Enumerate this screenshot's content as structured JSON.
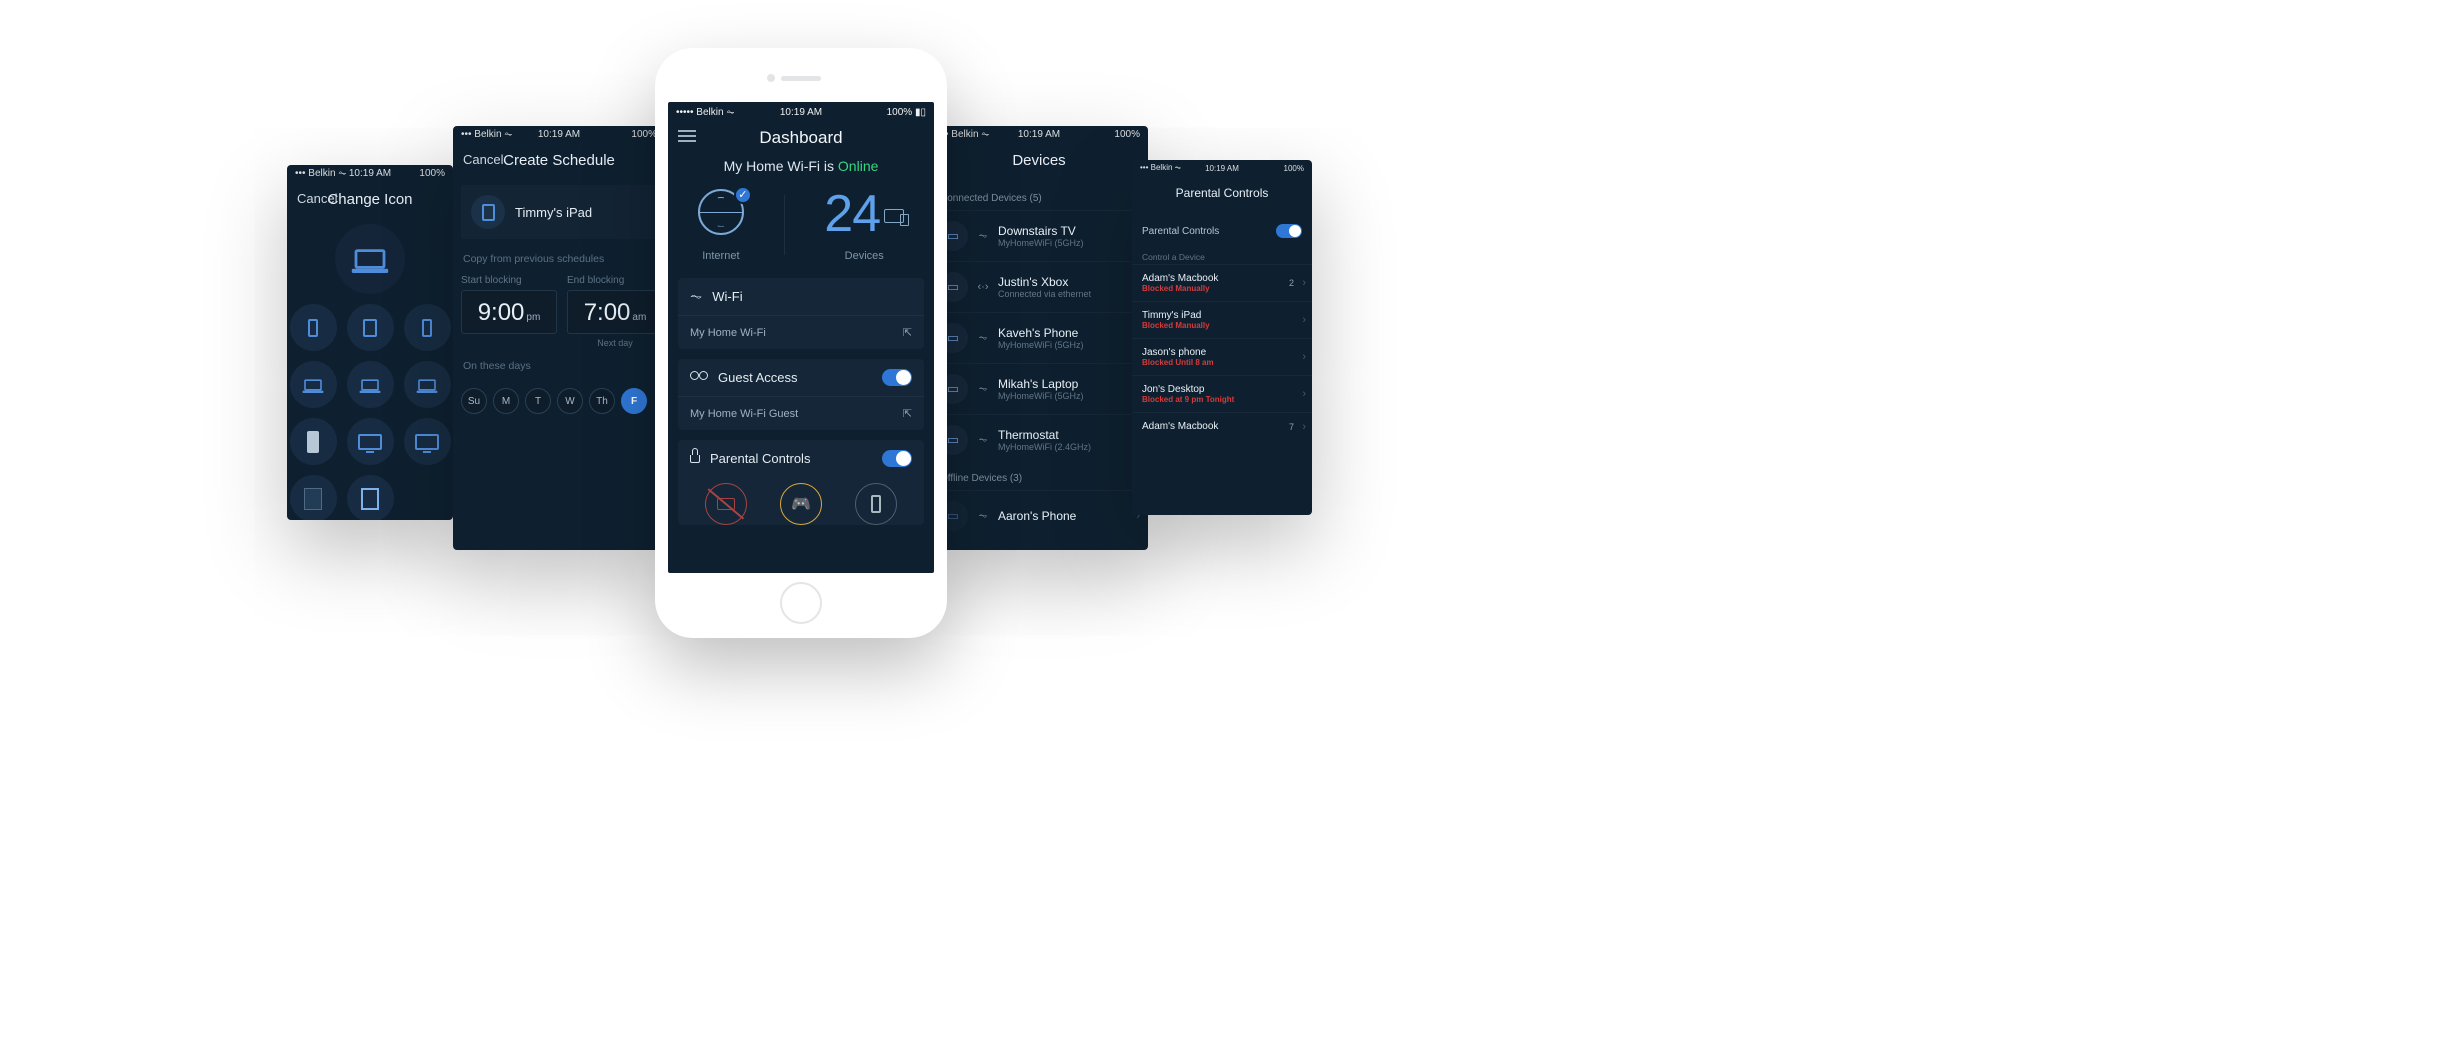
{
  "status": {
    "carrier": "Belkin",
    "time": "10:19 AM",
    "battery": "100%"
  },
  "center": {
    "title": "Dashboard",
    "headline_prefix": "My Home Wi-Fi is ",
    "headline_status": "Online",
    "internet_label": "Internet",
    "device_count": "24",
    "devices_label": "Devices",
    "wifi_label": "Wi-Fi",
    "wifi_network": "My Home Wi-Fi",
    "guest_label": "Guest Access",
    "guest_network": "My Home Wi-Fi Guest",
    "parental_label": "Parental Controls"
  },
  "schedule": {
    "cancel": "Cancel",
    "title": "Create Schedule",
    "device": "Timmy's iPad",
    "copy_hint": "Copy from previous schedules",
    "start_label": "Start blocking",
    "end_label": "End blocking",
    "start_time": "9:00",
    "start_ampm": "pm",
    "end_time": "7:00",
    "end_ampm": "am",
    "next_day": "Next day",
    "days_label": "On these days",
    "days": [
      "Su",
      "M",
      "T",
      "W",
      "Th",
      "F"
    ],
    "selected_day": "F"
  },
  "change_icon": {
    "cancel": "Cancel",
    "title": "Change Icon"
  },
  "devices": {
    "title": "Devices",
    "connected_hdr": "Connected Devices (5)",
    "offline_hdr": "Offline Devices   (3)",
    "list": [
      {
        "name": "Downstairs TV",
        "sub": "MyHomeWiFi     (5GHz)",
        "wifi": true
      },
      {
        "name": "Justin's Xbox",
        "sub": "Connected via ethernet",
        "wifi": false
      },
      {
        "name": "Kaveh's Phone",
        "sub": "MyHomeWiFi     (5GHz)",
        "wifi": true
      },
      {
        "name": "Mikah's Laptop",
        "sub": "MyHomeWiFi     (5GHz)",
        "wifi": true
      },
      {
        "name": "Thermostat",
        "sub": "MyHomeWiFi     (2.4GHz)",
        "wifi": true
      }
    ],
    "offline": {
      "name": "Aaron's Phone"
    }
  },
  "parental": {
    "title": "Parental Controls",
    "toggle_label": "Parental Controls",
    "control_hdr": "Control a Device",
    "rows": [
      {
        "t": "Adam's Macbook",
        "s": "Blocked Manually",
        "cnt": "2"
      },
      {
        "t": "Timmy's iPad",
        "s": "Blocked Manually"
      },
      {
        "t": "Jason's phone",
        "s": "Blocked Until 8 am"
      },
      {
        "t": "Jon's Desktop",
        "s": "Blocked at 9 pm Tonight"
      },
      {
        "t": "Adam's Macbook",
        "s": "",
        "cnt": "7"
      }
    ]
  }
}
